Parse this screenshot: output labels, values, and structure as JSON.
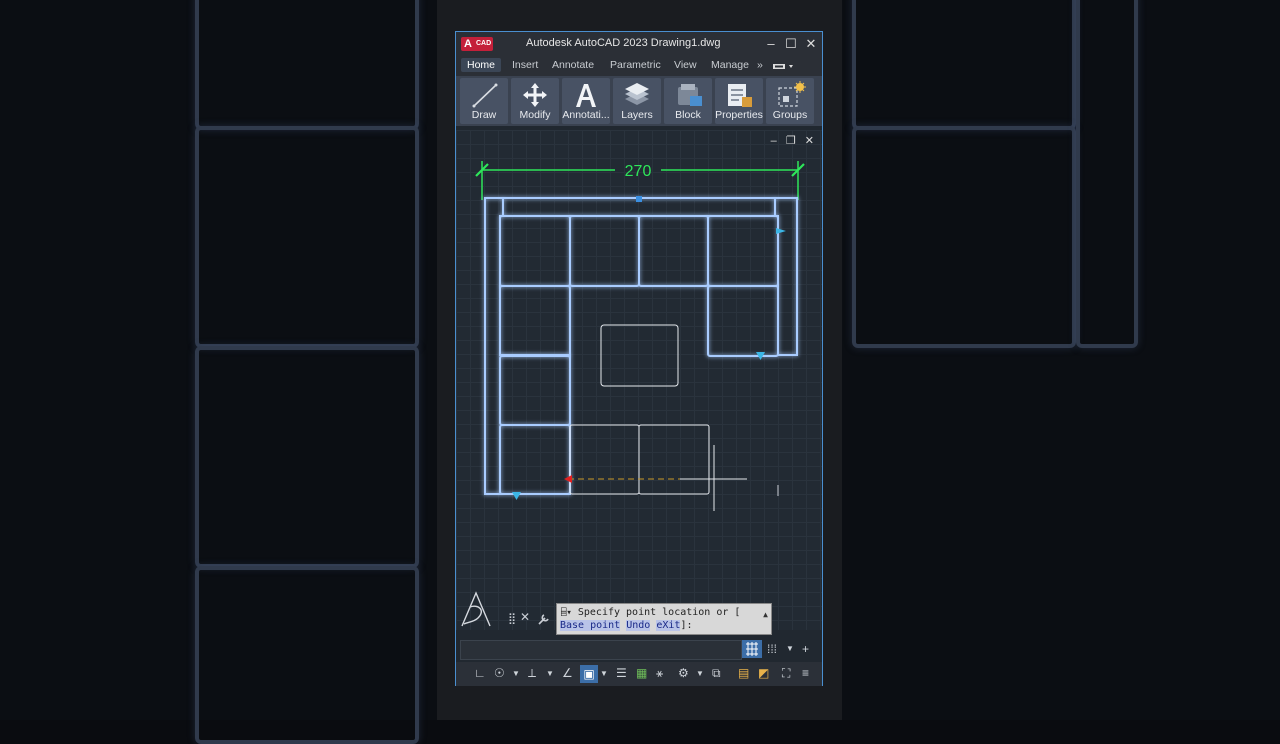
{
  "window": {
    "title": "Autodesk AutoCAD 2023   Drawing1.dwg",
    "logo_letter": "A",
    "logo_tag": "CAD",
    "minimize": "–",
    "maximize": "☐",
    "close": "✕"
  },
  "tabs": [
    "Home",
    "Insert",
    "Annotate",
    "Parametric",
    "View",
    "Manage"
  ],
  "tabs_overflow": "»",
  "ribbon": [
    {
      "label": "Draw",
      "icon": "line-icon"
    },
    {
      "label": "Modify",
      "icon": "move-icon"
    },
    {
      "label": "Annotati...",
      "icon": "text-a-icon"
    },
    {
      "label": "Layers",
      "icon": "layers-icon"
    },
    {
      "label": "Block",
      "icon": "block-icon"
    },
    {
      "label": "Properties",
      "icon": "properties-icon"
    },
    {
      "label": "Groups",
      "icon": "groups-icon"
    }
  ],
  "viewport_controls": {
    "minimize": "–",
    "restore": "❐",
    "close": "✕"
  },
  "drawing": {
    "dimension_text": "270",
    "dimension_color": "#2ee65a",
    "object_color": "#9ec4ff"
  },
  "command": {
    "prompt": "Specify point location or [",
    "options": [
      "Base point",
      "Undo",
      "eXit"
    ],
    "suffix": "]:"
  },
  "accent": "#4a8fd0"
}
